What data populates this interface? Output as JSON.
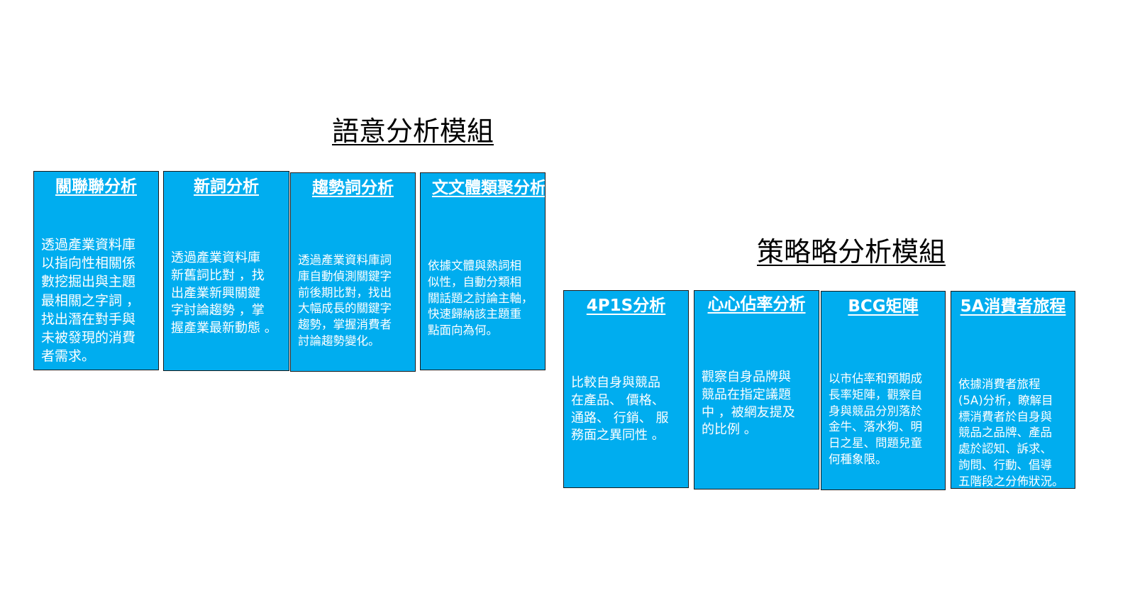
{
  "semantic_module": {
    "title": "語意分析模組",
    "cards": [
      {
        "title": "關聯聯分析",
        "desc": "透過產業資料庫\n以指向性相關係\n數挖掘出與主題\n最相關之字詞 ，\n找出潛在對手與\n未被發現的消費\n者需求。"
      },
      {
        "title": "新詞分析",
        "desc": "透過產業資料庫\n新舊詞比對 ，找\n出產業新興關鍵\n字討論趨勢 ，掌\n握產業最新動態 。"
      },
      {
        "title": "趨勢詞分析",
        "desc": "透過產業資料庫詞\n庫自動偵測關鍵字\n前後期比對，找出\n大幅成長的關鍵字\n趨勢，掌握消費者\n討論趨勢變化。"
      },
      {
        "title": "文文體類聚分析",
        "desc": "依據文體與熱詞相\n似性，自動分類相\n關話題之討論主軸，\n快速歸納該主題重\n點面向為何。"
      }
    ]
  },
  "strategy_module": {
    "title": "策略略分析模組",
    "cards": [
      {
        "title": "4P1S分析",
        "desc": "比較自身與競品\n在產品、 價格、\n通路、 行銷、 服\n務面之異同性 。"
      },
      {
        "title": "心心佔率分析",
        "desc": "觀察自身品牌與\n競品在指定議題\n中 ，被網友提及\n的比例 。"
      },
      {
        "title": "BCG矩陣",
        "desc": "以市佔率和預期成\n長率矩陣，觀察自\n身與競品分別落於\n金牛、落水狗、明\n日之星、問題兒童\n何種象限。"
      },
      {
        "title": "5A消費者旅程",
        "desc": "依據消費者旅程\n(5A)分析，瞭解目\n標消費者於自身與\n競品之品牌、產品\n處於認知、訴求、\n詢問、行動、倡導\n五階段之分佈狀況。"
      }
    ]
  }
}
